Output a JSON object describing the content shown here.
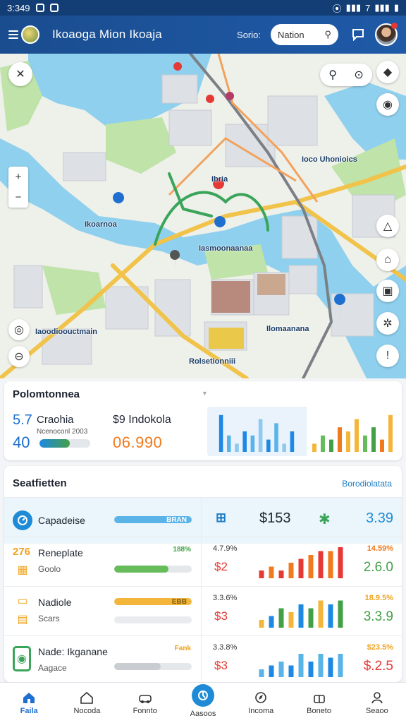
{
  "status_bar": {
    "time": "3:349",
    "right": "7"
  },
  "header": {
    "title": "Ikoaoga Mion Ikoaja",
    "scope_label": "Sorio:",
    "search_value": "Nation"
  },
  "map": {
    "labels": [
      "Ioco Uhonioics",
      "Ikoarnoa",
      "Iasmoonaanaa",
      "Iaoodioouctmain",
      "Ilomaanana",
      "Rolsetionniii",
      "Ibria"
    ],
    "colors": {
      "water": "#8fd0ee",
      "land": "#eef0ea",
      "park": "#bfe3a8",
      "road_major": "#f1c34a",
      "route": "#3aa55a"
    }
  },
  "performance": {
    "title": "Polomtonnea",
    "kpi1_value": "5.7",
    "kpi1_label": "Craohia",
    "kpi1_sub": "Ncenoconl 2003",
    "kpi1_second": "40",
    "kpi1_progress": 0.6,
    "kpi2_value": "$9",
    "kpi2_label": "Indokola",
    "kpi2_big": "06.990"
  },
  "stations": {
    "title": "Seatfietten",
    "link": "Borodiolatata",
    "rows": [
      {
        "num": "",
        "name": "Capadeise",
        "sub": "",
        "bar_value": "BRAN",
        "bar_fill": 1.0,
        "bar_color": "#5ab4e8",
        "pct_l": "",
        "pct_r": "",
        "left_val": "$153",
        "right_val": "3.39",
        "right_color": "#1f8bd6",
        "icon": "gauge-icon",
        "chart_colors": [
          "#1e88e5"
        ]
      },
      {
        "num": "276",
        "name": "Reneplate",
        "sub": "Goolo",
        "bar_value": "188%",
        "bar_fill": 0.7,
        "bar_color": "#66bb5a",
        "pct_l": "4.7.9%",
        "pct_r": "14.59%",
        "left_val": "$2",
        "right_val": "2.6.0",
        "right_color": "#43a047",
        "icon": "storage-icon",
        "chart_colors": [
          "#e53935",
          "#f07a1e"
        ]
      },
      {
        "num": "",
        "name": "Nadiole",
        "sub": "Scars",
        "bar_value": "EBB",
        "bar_fill": 1.0,
        "bar_color": "#f4b63a",
        "pct_l": "3.3.6%",
        "pct_r": "18.9.5%",
        "left_val": "$3",
        "right_val": "3.3.9",
        "right_color": "#43a047",
        "icon": "battery-icon",
        "chart_colors": [
          "#f4b63a",
          "#1e88e5",
          "#43a047"
        ]
      },
      {
        "num": "",
        "name": "Nade: Ikganane",
        "sub": "Aagace",
        "bar_value": "Fank",
        "bar_fill": 0.6,
        "bar_color": "#c9cdd2",
        "pct_l": "3.3.8%",
        "pct_r": "$23.5%",
        "left_val": "$3",
        "right_val": "$.2.5",
        "right_color": "#e53935",
        "icon": "phone-icon",
        "chart_colors": [
          "#5ab4e8",
          "#1e88e5"
        ]
      }
    ]
  },
  "nav": [
    "Faila",
    "Nocoda",
    "Fonnto",
    "Aasoos",
    "Incoma",
    "Boneto",
    "Seaoo"
  ],
  "chart_data": {
    "type": "bar",
    "series": [
      {
        "values": [
          9,
          4,
          2,
          5,
          4,
          8,
          3,
          7,
          2,
          5
        ]
      },
      {
        "values": [
          2,
          4,
          3,
          6,
          5,
          8,
          4,
          6,
          3,
          9
        ]
      }
    ]
  }
}
